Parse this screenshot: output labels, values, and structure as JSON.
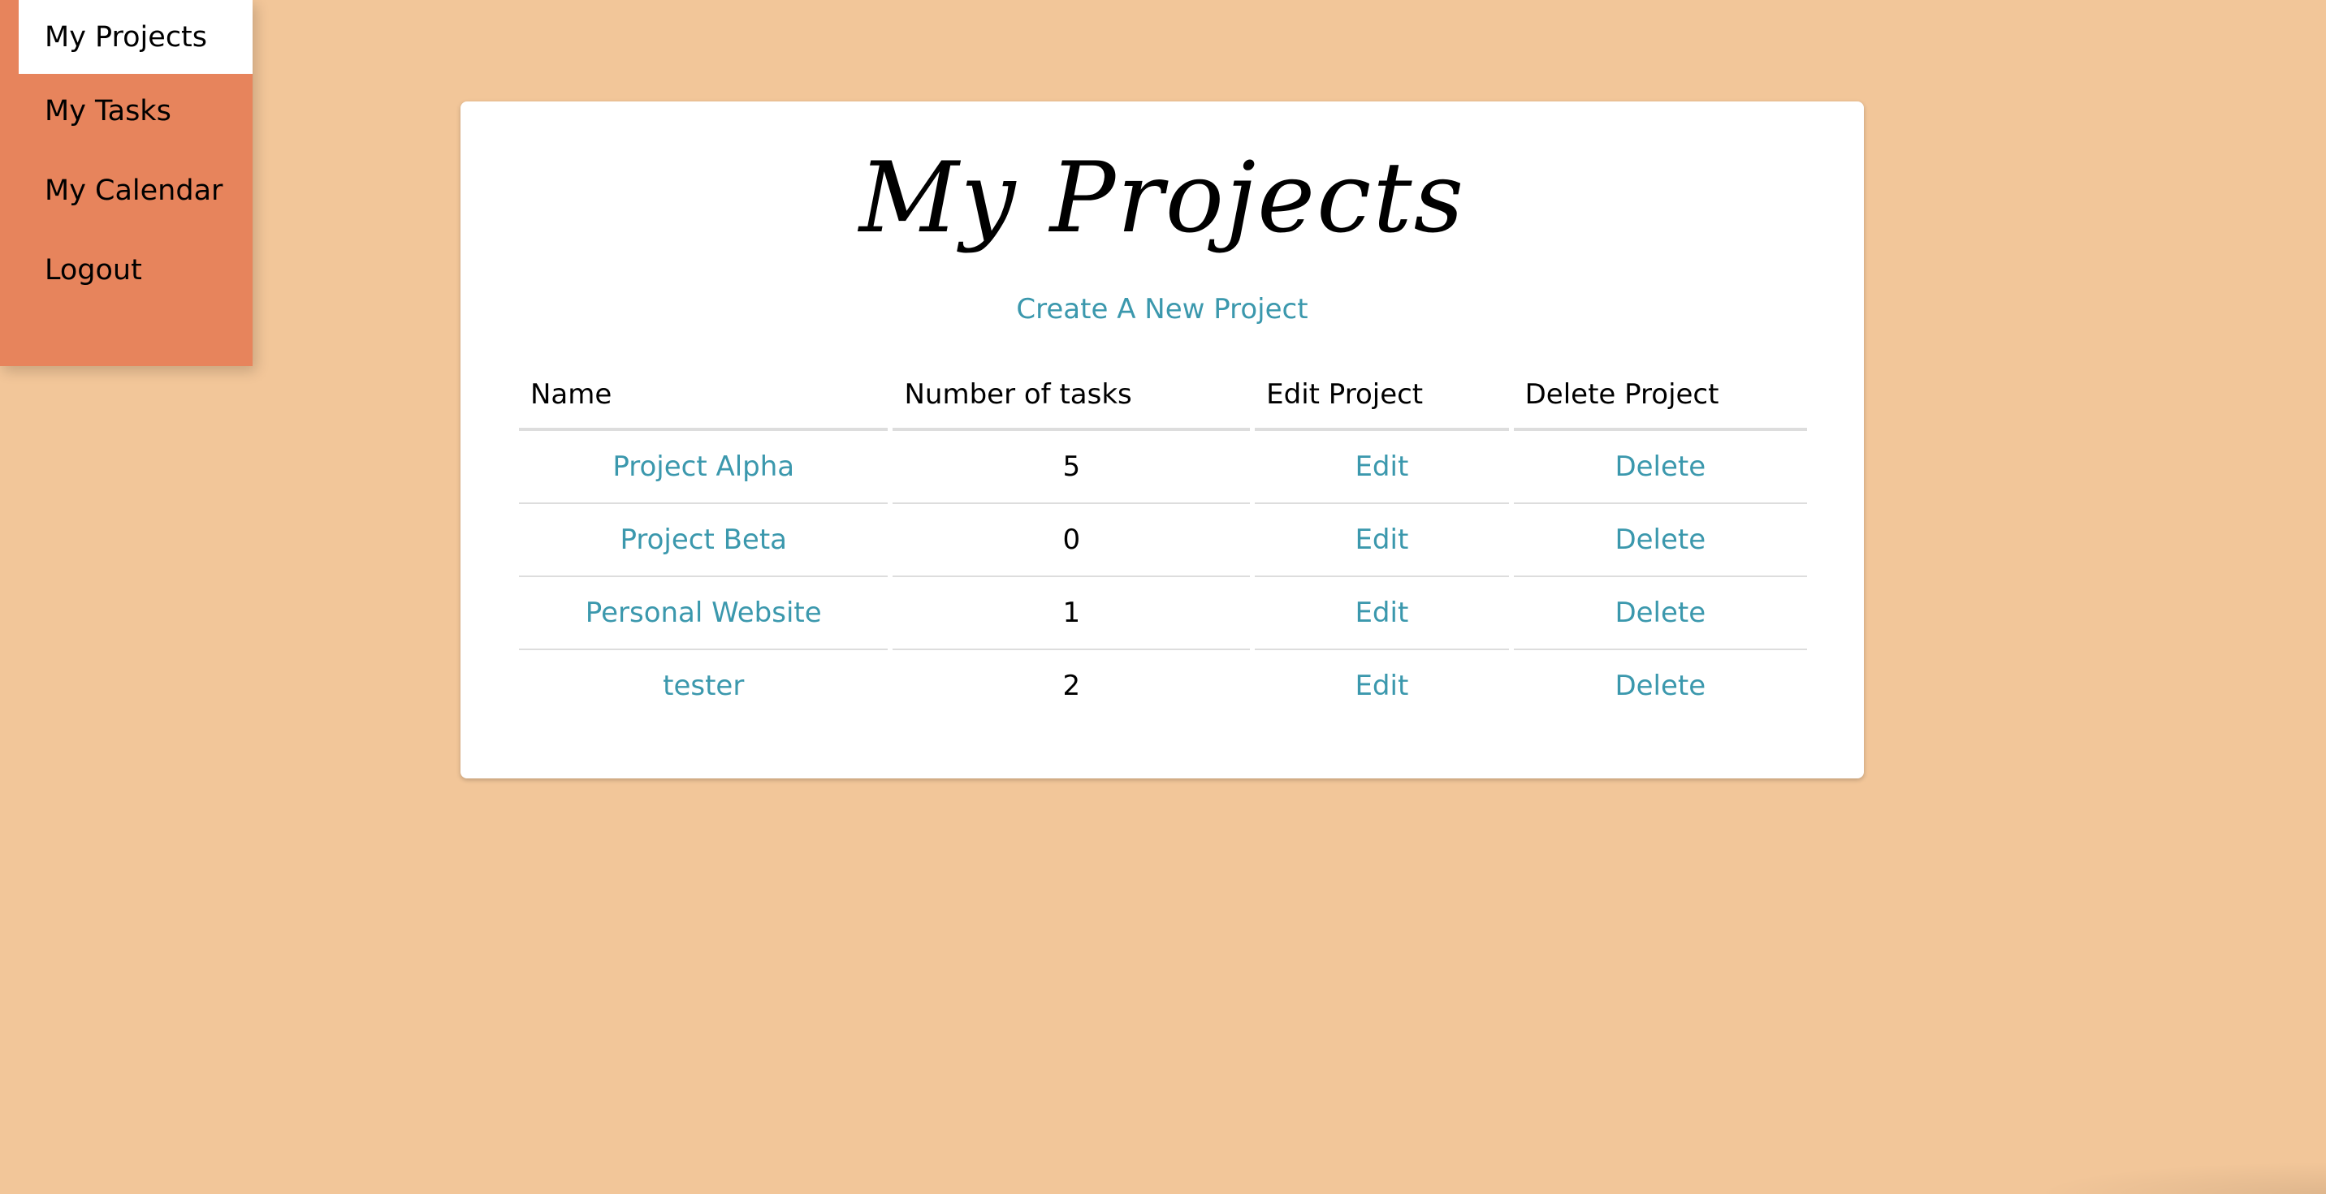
{
  "sidebar": {
    "items": [
      {
        "label": "My Projects",
        "active": true
      },
      {
        "label": "My Tasks",
        "active": false
      },
      {
        "label": "My Calendar",
        "active": false
      },
      {
        "label": "Logout",
        "active": false
      }
    ]
  },
  "main": {
    "title": "My Projects",
    "create_link": "Create A New Project",
    "table": {
      "headers": [
        "Name",
        "Number of tasks",
        "Edit Project",
        "Delete Project"
      ],
      "rows": [
        {
          "name": "Project Alpha",
          "tasks": "5",
          "edit": "Edit",
          "delete": "Delete"
        },
        {
          "name": "Project Beta",
          "tasks": "0",
          "edit": "Edit",
          "delete": "Delete"
        },
        {
          "name": "Personal Website",
          "tasks": "1",
          "edit": "Edit",
          "delete": "Delete"
        },
        {
          "name": "tester",
          "tasks": "2",
          "edit": "Edit",
          "delete": "Delete"
        }
      ]
    }
  },
  "colors": {
    "background": "#f2c699",
    "sidebar": "#e7845c",
    "link": "#3b98ad",
    "card": "#ffffff"
  }
}
